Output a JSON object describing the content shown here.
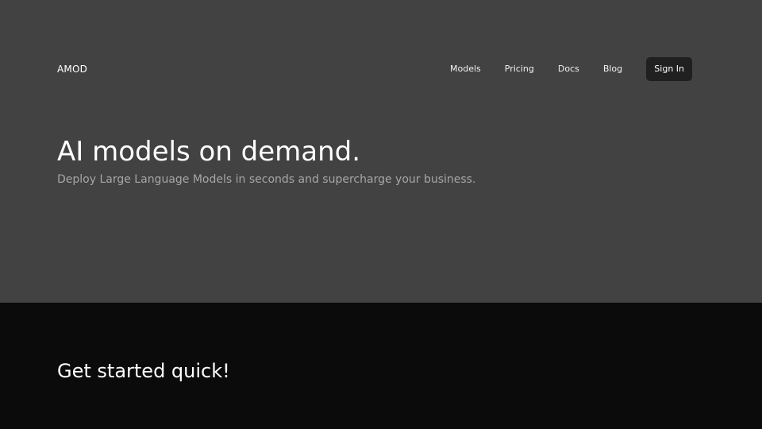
{
  "header": {
    "logo": "AMOD",
    "nav": [
      {
        "label": "Models"
      },
      {
        "label": "Pricing"
      },
      {
        "label": "Docs"
      },
      {
        "label": "Blog"
      }
    ],
    "signin_label": "Sign In"
  },
  "hero": {
    "title": "AI models on demand.",
    "subtitle": "Deploy Large Language Models in seconds and supercharge your business."
  },
  "get_started": {
    "title": "Get started quick!"
  },
  "colors": {
    "hero_background": "#424242",
    "section_background": "#0b0b0b",
    "button_background": "#202020",
    "subtitle_text": "#a6a6a6"
  }
}
